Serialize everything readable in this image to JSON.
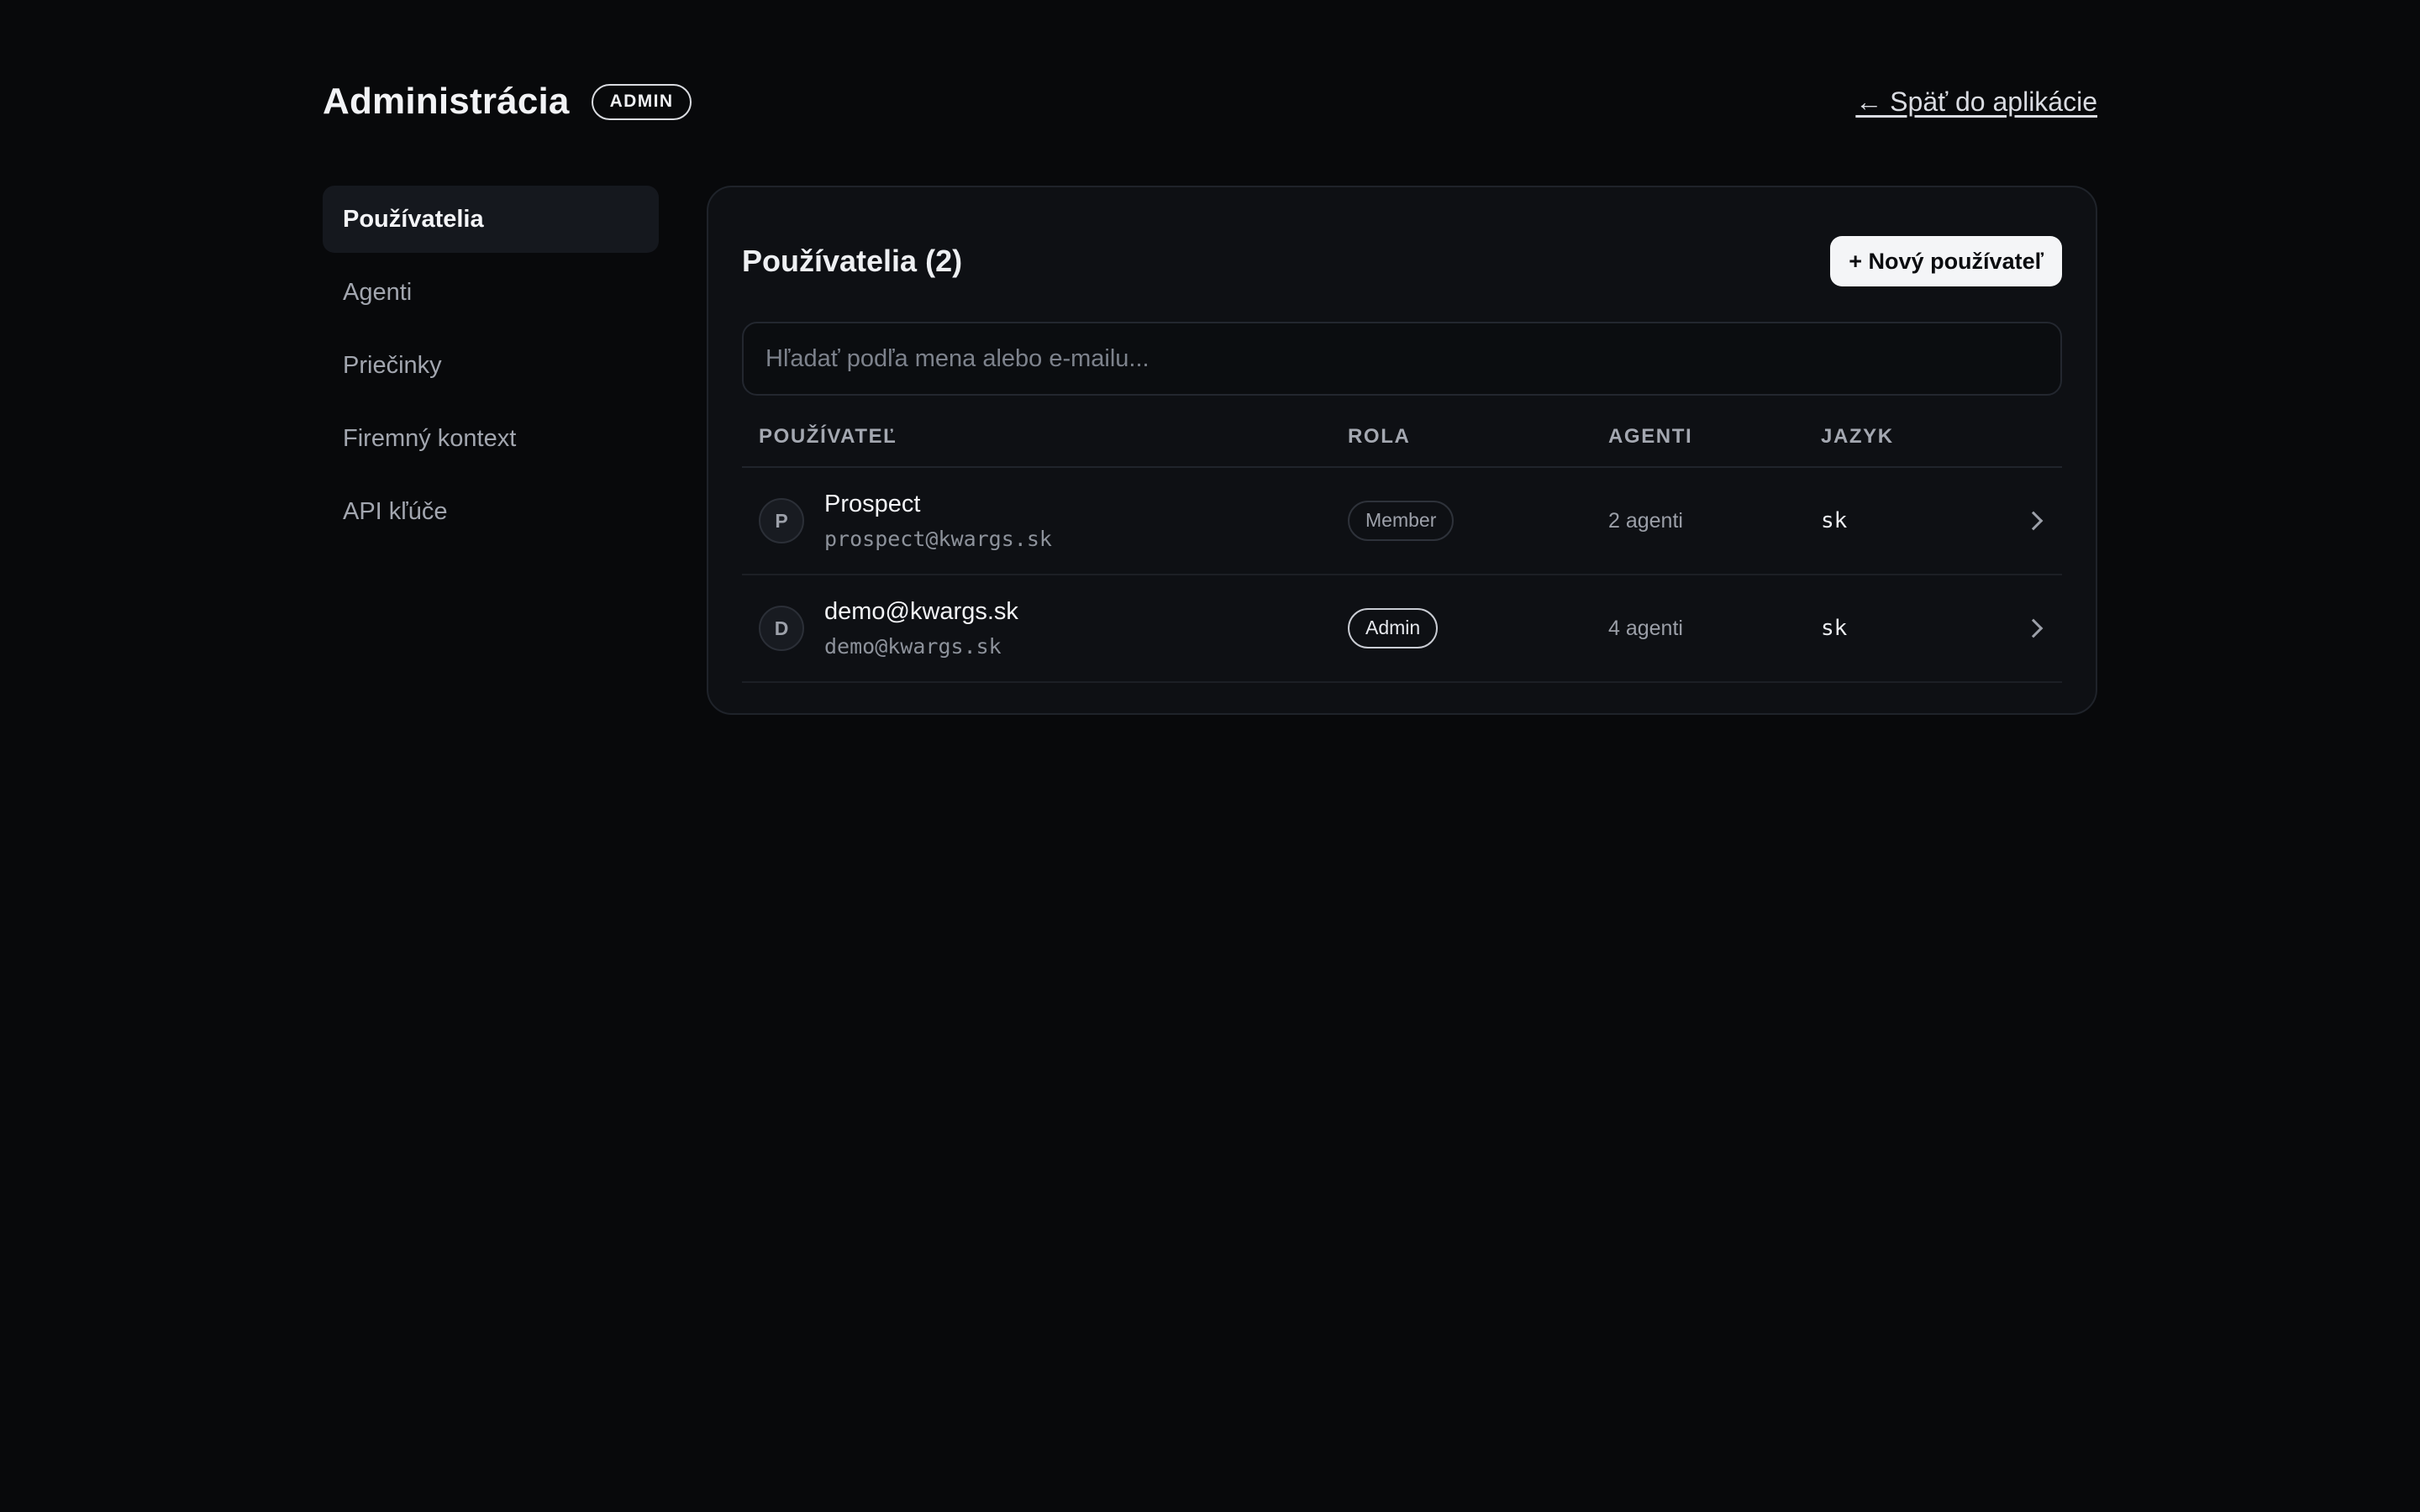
{
  "header": {
    "title": "Administrácia",
    "badge": "ADMIN",
    "back_link": "← Späť do aplikácie"
  },
  "sidebar": {
    "items": [
      {
        "label": "Používatelia",
        "active": true
      },
      {
        "label": "Agenti",
        "active": false
      },
      {
        "label": "Priečinky",
        "active": false
      },
      {
        "label": "Firemný kontext",
        "active": false
      },
      {
        "label": "API kľúče",
        "active": false
      }
    ]
  },
  "panel": {
    "title": "Používatelia (2)",
    "new_button": "+ Nový používateľ",
    "search": {
      "placeholder": "Hľadať podľa mena alebo e-mailu...",
      "value": ""
    }
  },
  "table": {
    "columns": [
      "POUŽÍVATEĽ",
      "ROLA",
      "AGENTI",
      "JAZYK"
    ],
    "rows": [
      {
        "initial": "P",
        "name": "Prospect",
        "email": "prospect@kwargs.sk",
        "role": "Member",
        "agents": "2 agenti",
        "lang": "sk"
      },
      {
        "initial": "D",
        "name": "demo@kwargs.sk",
        "email": "demo@kwargs.sk",
        "role": "Admin",
        "agents": "4 agenti",
        "lang": "sk"
      }
    ]
  },
  "colors": {
    "background": "#08090b",
    "panel": "#0e1014",
    "primary_button": "#f4f5f7"
  },
  "icons": {
    "row_arrow": "chevron-right-icon"
  }
}
